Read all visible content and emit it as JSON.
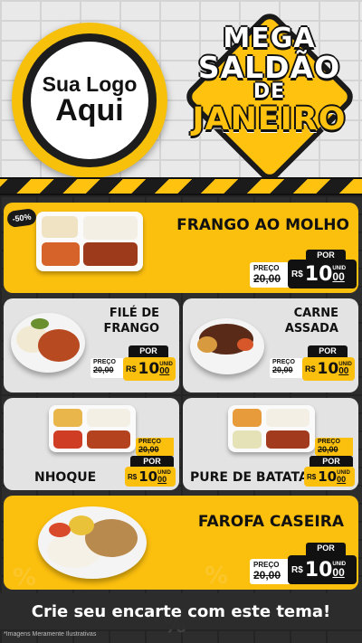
{
  "header": {
    "logo_line1": "Sua Logo",
    "logo_line2": "Aqui",
    "promo_line1": "MEGA",
    "promo_line2": "SALDÃO",
    "promo_line3": "DE",
    "promo_line4": "JANEIRO"
  },
  "badge": "-50%",
  "products": [
    {
      "name": "FRANGO AO MOLHO",
      "old_label": "PREÇO",
      "old_cents": "R$",
      "old_value": "20,00",
      "por_label": "POR",
      "currency": "R$",
      "price_int": "10",
      "price_dec": "00",
      "unid": "UNID"
    },
    {
      "name_line1": "FILÉ DE",
      "name_line2": "FRANGO",
      "old_label": "PREÇO",
      "old_cents": "R$",
      "old_value": "20,00",
      "por_label": "POR",
      "currency": "R$",
      "price_int": "10",
      "price_dec": "00",
      "unid": "UNID"
    },
    {
      "name_line1": "CARNE",
      "name_line2": "ASSADA",
      "old_label": "PREÇO",
      "old_cents": "R$",
      "old_value": "20,00",
      "por_label": "POR",
      "currency": "R$",
      "price_int": "10",
      "price_dec": "00",
      "unid": "UNID"
    },
    {
      "name": "NHOQUE",
      "old_label": "PREÇO",
      "old_cents": "R$",
      "old_value": "20,00",
      "por_label": "POR",
      "currency": "R$",
      "price_int": "10",
      "price_dec": "00",
      "unid": "UNID"
    },
    {
      "name": "PURE DE BATATA",
      "old_label": "PREÇO",
      "old_cents": "R$",
      "old_value": "20,00",
      "por_label": "POR",
      "currency": "R$",
      "price_int": "10",
      "price_dec": "00",
      "unid": "UNID"
    },
    {
      "name": "FAROFA CASEIRA",
      "old_label": "PREÇO",
      "old_cents": "R$",
      "old_value": "20,00",
      "por_label": "POR",
      "currency": "R$",
      "price_int": "10",
      "price_dec": "00",
      "unid": "UNID"
    }
  ],
  "cta": "Crie seu encarte com este tema!",
  "footnote": "*Imagens Meramente Ilustrativas",
  "colors": {
    "accent_yellow": "#fbbf0e",
    "dark": "#111111",
    "card_gray": "#e3e3e3"
  }
}
